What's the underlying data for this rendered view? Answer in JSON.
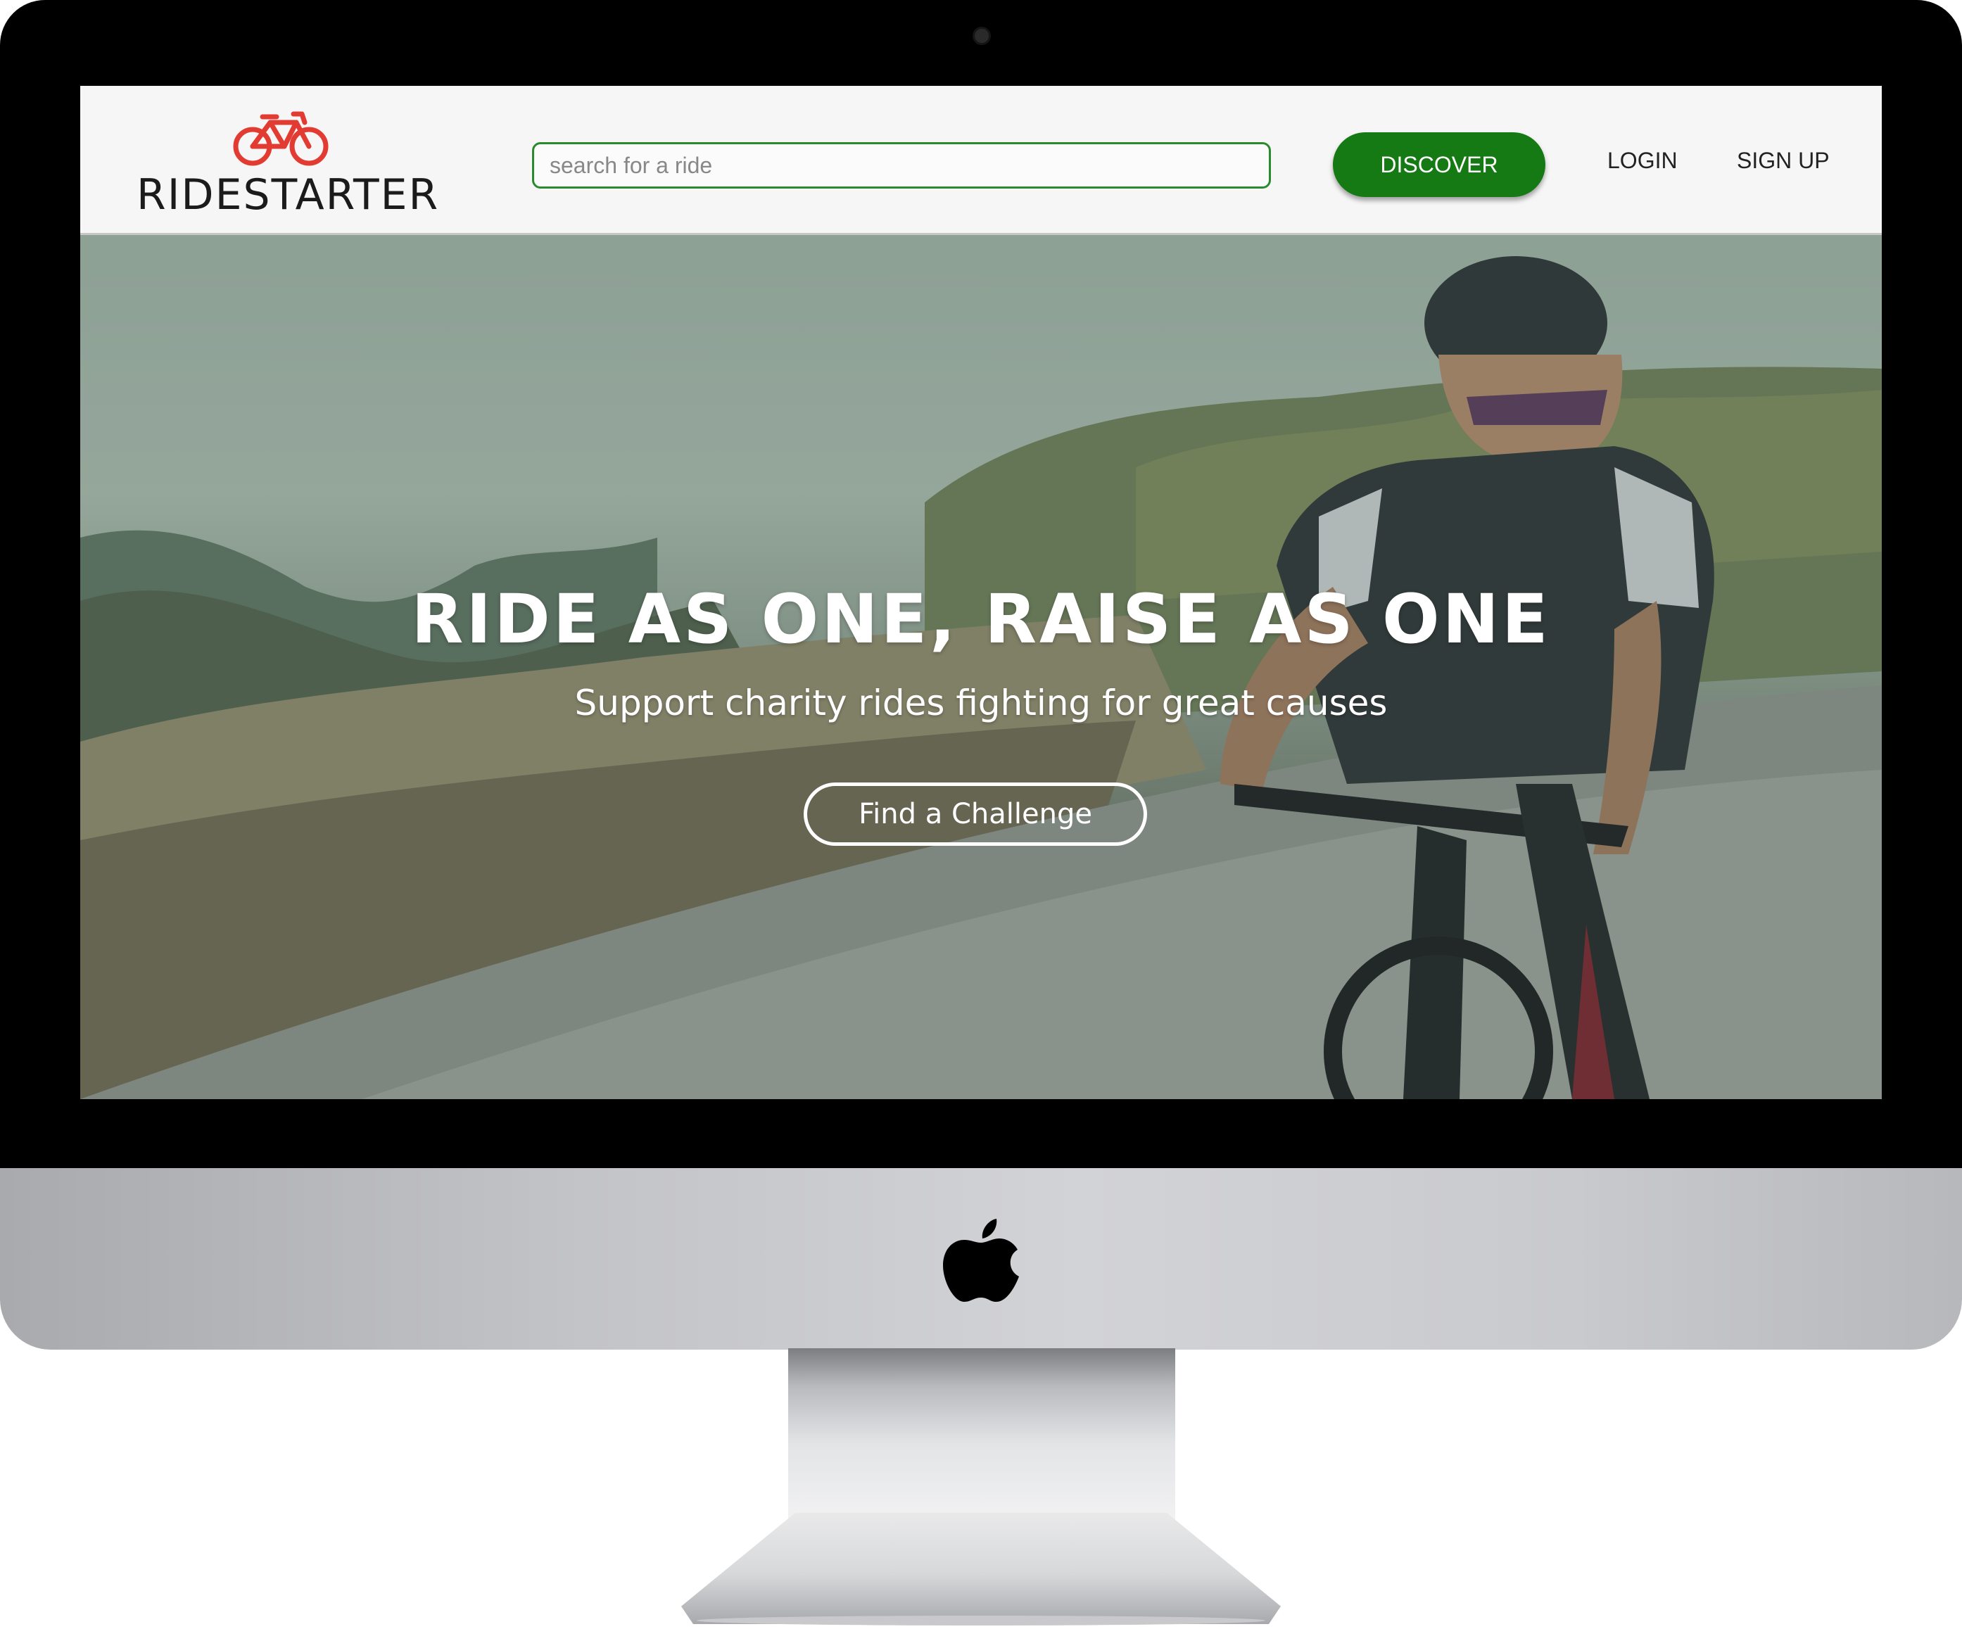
{
  "brand": {
    "name": "RIDESTARTER",
    "icon": "bicycle-icon",
    "icon_color": "#e23b32"
  },
  "search": {
    "placeholder": "search for a ride",
    "value": ""
  },
  "nav": {
    "discover_label": "DISCOVER",
    "login_label": "LOGIN",
    "signup_label": "SIGN UP",
    "accent_color": "#157a14"
  },
  "hero": {
    "headline": "RIDE AS ONE, RAISE AS ONE",
    "subheadline": "Support charity rides fighting for great causes",
    "cta_label": "Find a Challenge",
    "image": "cyclist-on-mountain-road"
  },
  "device": {
    "logo": "apple-logo-icon"
  }
}
